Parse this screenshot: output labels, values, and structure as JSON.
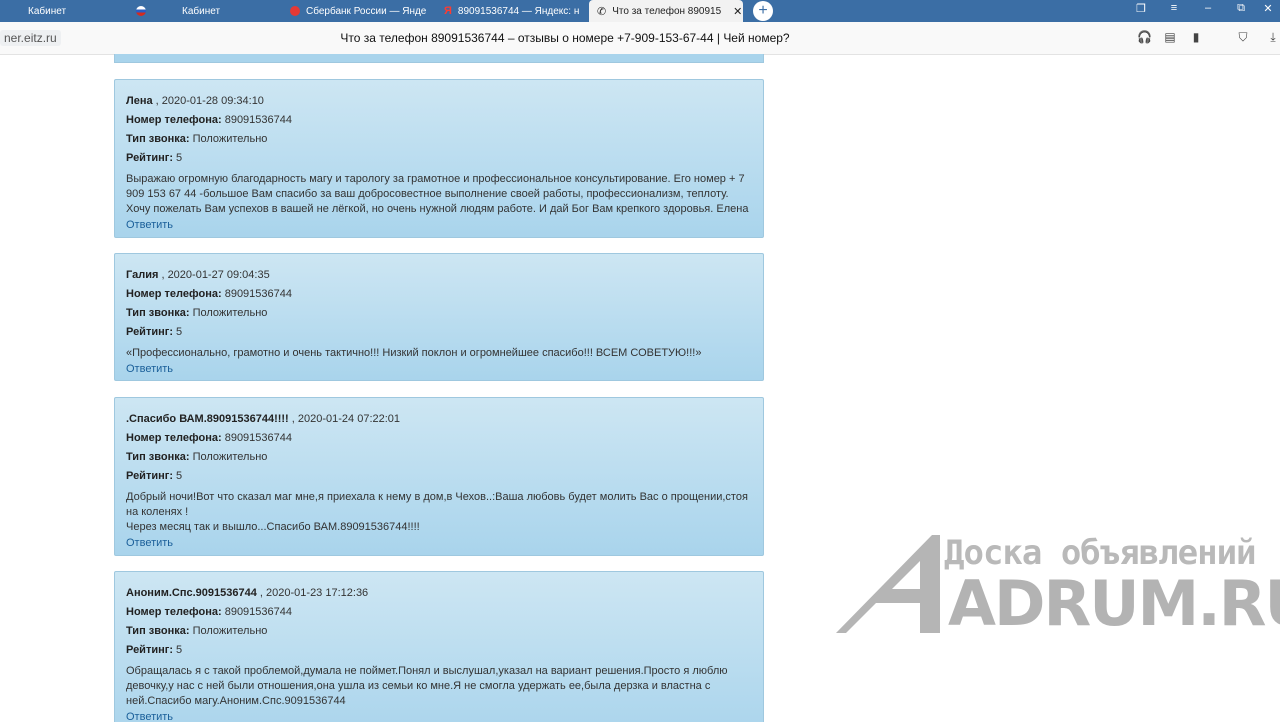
{
  "tabs": [
    {
      "label": "Кабинет",
      "icon": "blank-icon",
      "active": false
    },
    {
      "label": "Кабинет",
      "icon": "flag-icon",
      "active": false
    },
    {
      "label": "Сбербанк России — Янде",
      "icon": "location-pin-icon",
      "active": false
    },
    {
      "label": "89091536744 — Яндекс: н",
      "icon": "yandex-icon",
      "active": false
    },
    {
      "label": "Что за телефон 890915",
      "icon": "phone-icon",
      "active": true
    }
  ],
  "address": {
    "domain": "ner.eitz.ru",
    "title": "Что за телефон 89091536744 – отзывы о номере +7-909-153-67-44 | Чей номер?"
  },
  "labels": {
    "phone": "Номер телефона:",
    "type": "Тип звонка:",
    "rating": "Рейтинг:",
    "reply": "Ответить"
  },
  "reviews": [
    {
      "author": "Лена",
      "date": ", 2020-01-28 09:34:10",
      "phone": "89091536744",
      "type": "Положительно",
      "rating": "5",
      "text": "Выражаю огромную благодарность магу и тарологу за грамотное и профессиональное консультирование. Его номер + 7 909 153 67 44 -большое Вам спасибо за ваш добросовестное выполнение своей работы, профессионализм, теплоту. Хочу пожелать Вам успехов в вашей не лёгкой, но очень нужной людям работе. И дай Бог Вам крепкого здоровья. Елена"
    },
    {
      "author": "Галия",
      "date": ", 2020-01-27 09:04:35",
      "phone": "89091536744",
      "type": "Положительно",
      "rating": "5",
      "text": "«Профессионально, грамотно и очень тактично!!! Низкий поклон и огромнейшее спасибо!!! ВСЕМ СОВЕТУЮ!!!»"
    },
    {
      "author": ".Спасибо ВАМ.89091536744!!!!",
      "date": ", 2020-01-24 07:22:01",
      "phone": "89091536744",
      "type": "Положительно",
      "rating": "5",
      "text": "Добрый ночи!Вот что сказал маг мне,я приехала к нему в дом,в Чехов..:Ваша любовь будет молить Вас о прощении,стоя на коленях !\nЧерез месяц так и вышло...Спасибо ВАМ.89091536744!!!!"
    },
    {
      "author": "Аноним.Спс.9091536744",
      "date": ", 2020-01-23 17:12:36",
      "phone": "89091536744",
      "type": "Положительно",
      "rating": "5",
      "text": "Обращалась я с такой проблемой,думала не поймет.Понял и выслушал,указал на вариант решения.Просто я люблю девочку,у нас с ней были отношения,она ушла из семьи ко мне.Я не смогла удержать ее,была дерзка и властна с ней.Спасибо магу.Аноним.Спс.9091536744"
    }
  ],
  "watermark": {
    "line1": "Доска объявлений",
    "line2": "ADRUM.RU"
  }
}
